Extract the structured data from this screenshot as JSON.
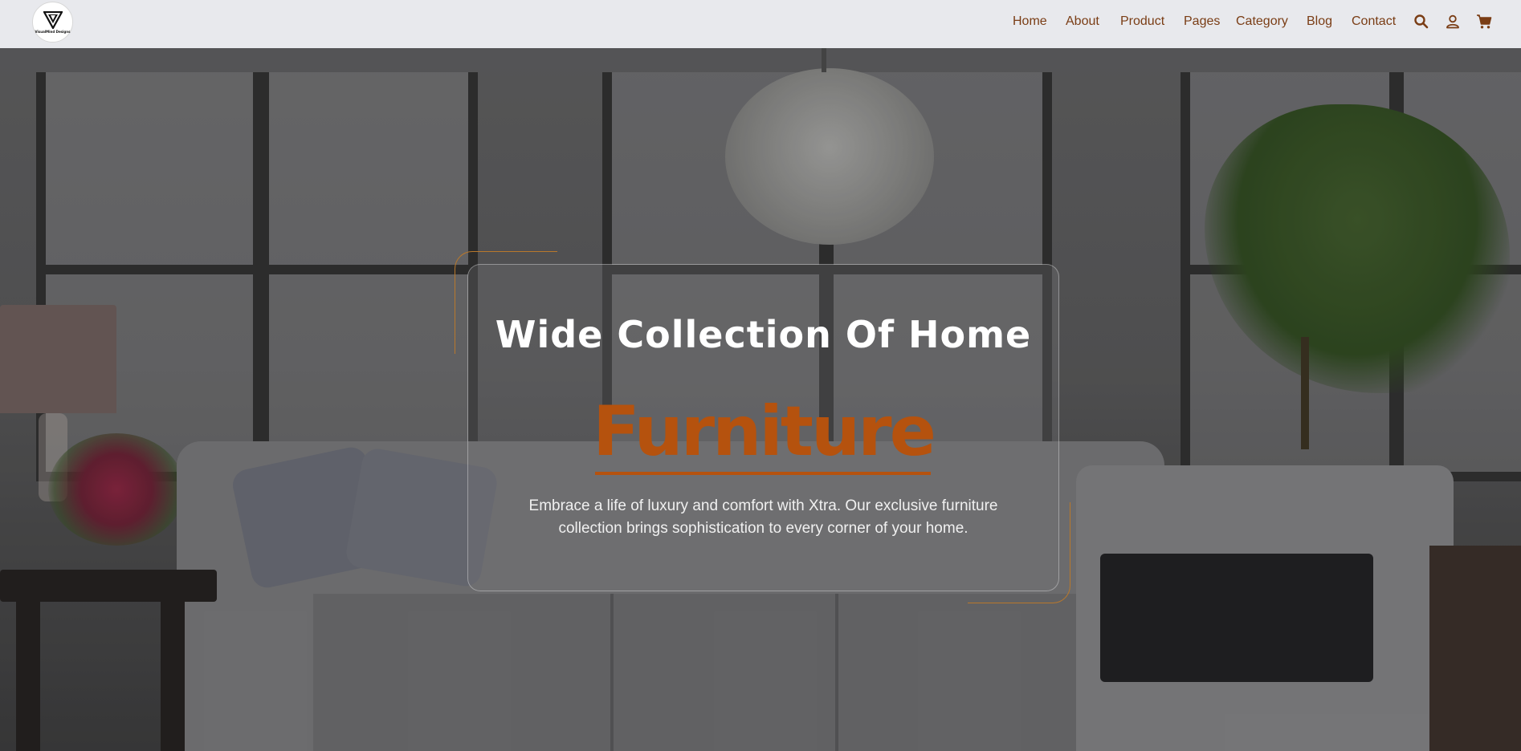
{
  "header": {
    "logo": {
      "icon": "v-monogram-logo",
      "text": "VisualMind Designs"
    },
    "nav": [
      {
        "label": "Home"
      },
      {
        "label": "About"
      },
      {
        "label": "Product"
      },
      {
        "label": "Pages"
      },
      {
        "label": "Category"
      },
      {
        "label": "Blog"
      },
      {
        "label": "Contact"
      }
    ],
    "icons": [
      "search-icon",
      "user-icon",
      "cart-icon"
    ],
    "accent": "#7a3d15"
  },
  "hero": {
    "title": "Wide Collection Of Home",
    "highlight": "Furniture",
    "description": "Embrace a life of luxury and comfort with Xtra. Our exclusive furniture collection brings sophistication to every corner of your home.",
    "accent": "#b5520e"
  }
}
